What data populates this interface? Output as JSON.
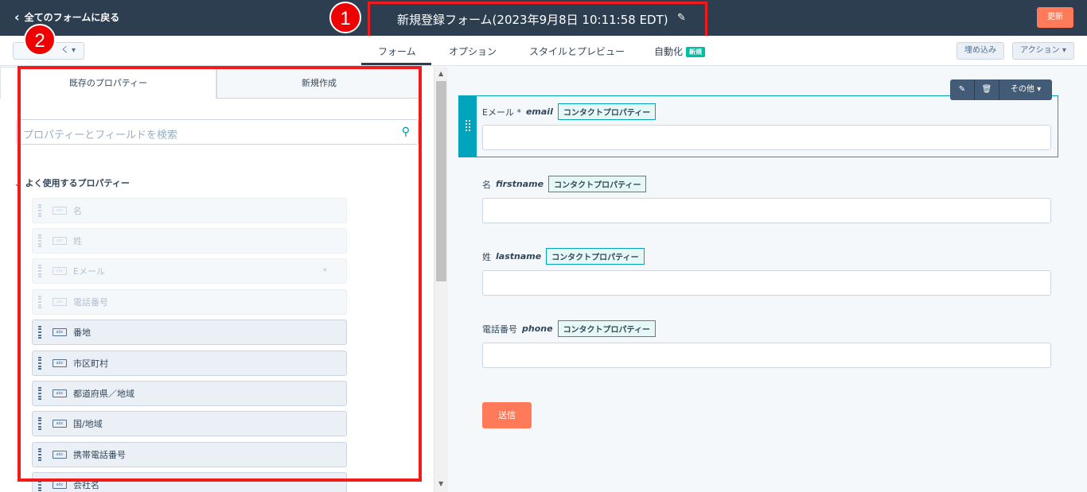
{
  "topbar": {
    "back_label": "全てのフォームに戻る",
    "form_title": "新規登録フォーム(2023年9月8日 10:11:58 EDT)",
    "update_label": "更新"
  },
  "annotations": {
    "badge1": "1",
    "badge2": "2"
  },
  "subnav": {
    "back_btn": "く",
    "tabs": [
      {
        "label": "フォーム"
      },
      {
        "label": "オプション"
      },
      {
        "label": "スタイルとプレビュー"
      },
      {
        "label": "自動化"
      }
    ],
    "new_tag": "新規",
    "embed_label": "埋め込み",
    "action_label": "アクション"
  },
  "left_panel": {
    "tab_existing": "既存のプロパティー",
    "tab_new": "新規作成",
    "search_placeholder": "プロパティーとフィールドを検索",
    "section_title": "よく使用するプロパティー",
    "properties": [
      {
        "label": "名",
        "enabled": false
      },
      {
        "label": "姓",
        "enabled": false
      },
      {
        "label": "Eメール",
        "enabled": false,
        "required": "*"
      },
      {
        "label": "電話番号",
        "enabled": false
      },
      {
        "label": "番地",
        "enabled": true
      },
      {
        "label": "市区町村",
        "enabled": true
      },
      {
        "label": "都道府県／地域",
        "enabled": true
      },
      {
        "label": "国/地域",
        "enabled": true
      },
      {
        "label": "携帯電話番号",
        "enabled": true
      },
      {
        "label": "会社名",
        "enabled": true
      }
    ]
  },
  "preview": {
    "toolbar_more": "その他",
    "contact_property": "コンタクトプロパティー",
    "fields": [
      {
        "label": "Eメール *",
        "internal": "email"
      },
      {
        "label": "名",
        "internal": "firstname"
      },
      {
        "label": "姓",
        "internal": "lastname"
      },
      {
        "label": "電話番号",
        "internal": "phone"
      }
    ],
    "submit_label": "送信"
  },
  "colors": {
    "topbar": "#2d3e50",
    "accent_orange": "#ff7a59",
    "teal": "#00a4bd",
    "annotation_red": "#f21b1b"
  }
}
